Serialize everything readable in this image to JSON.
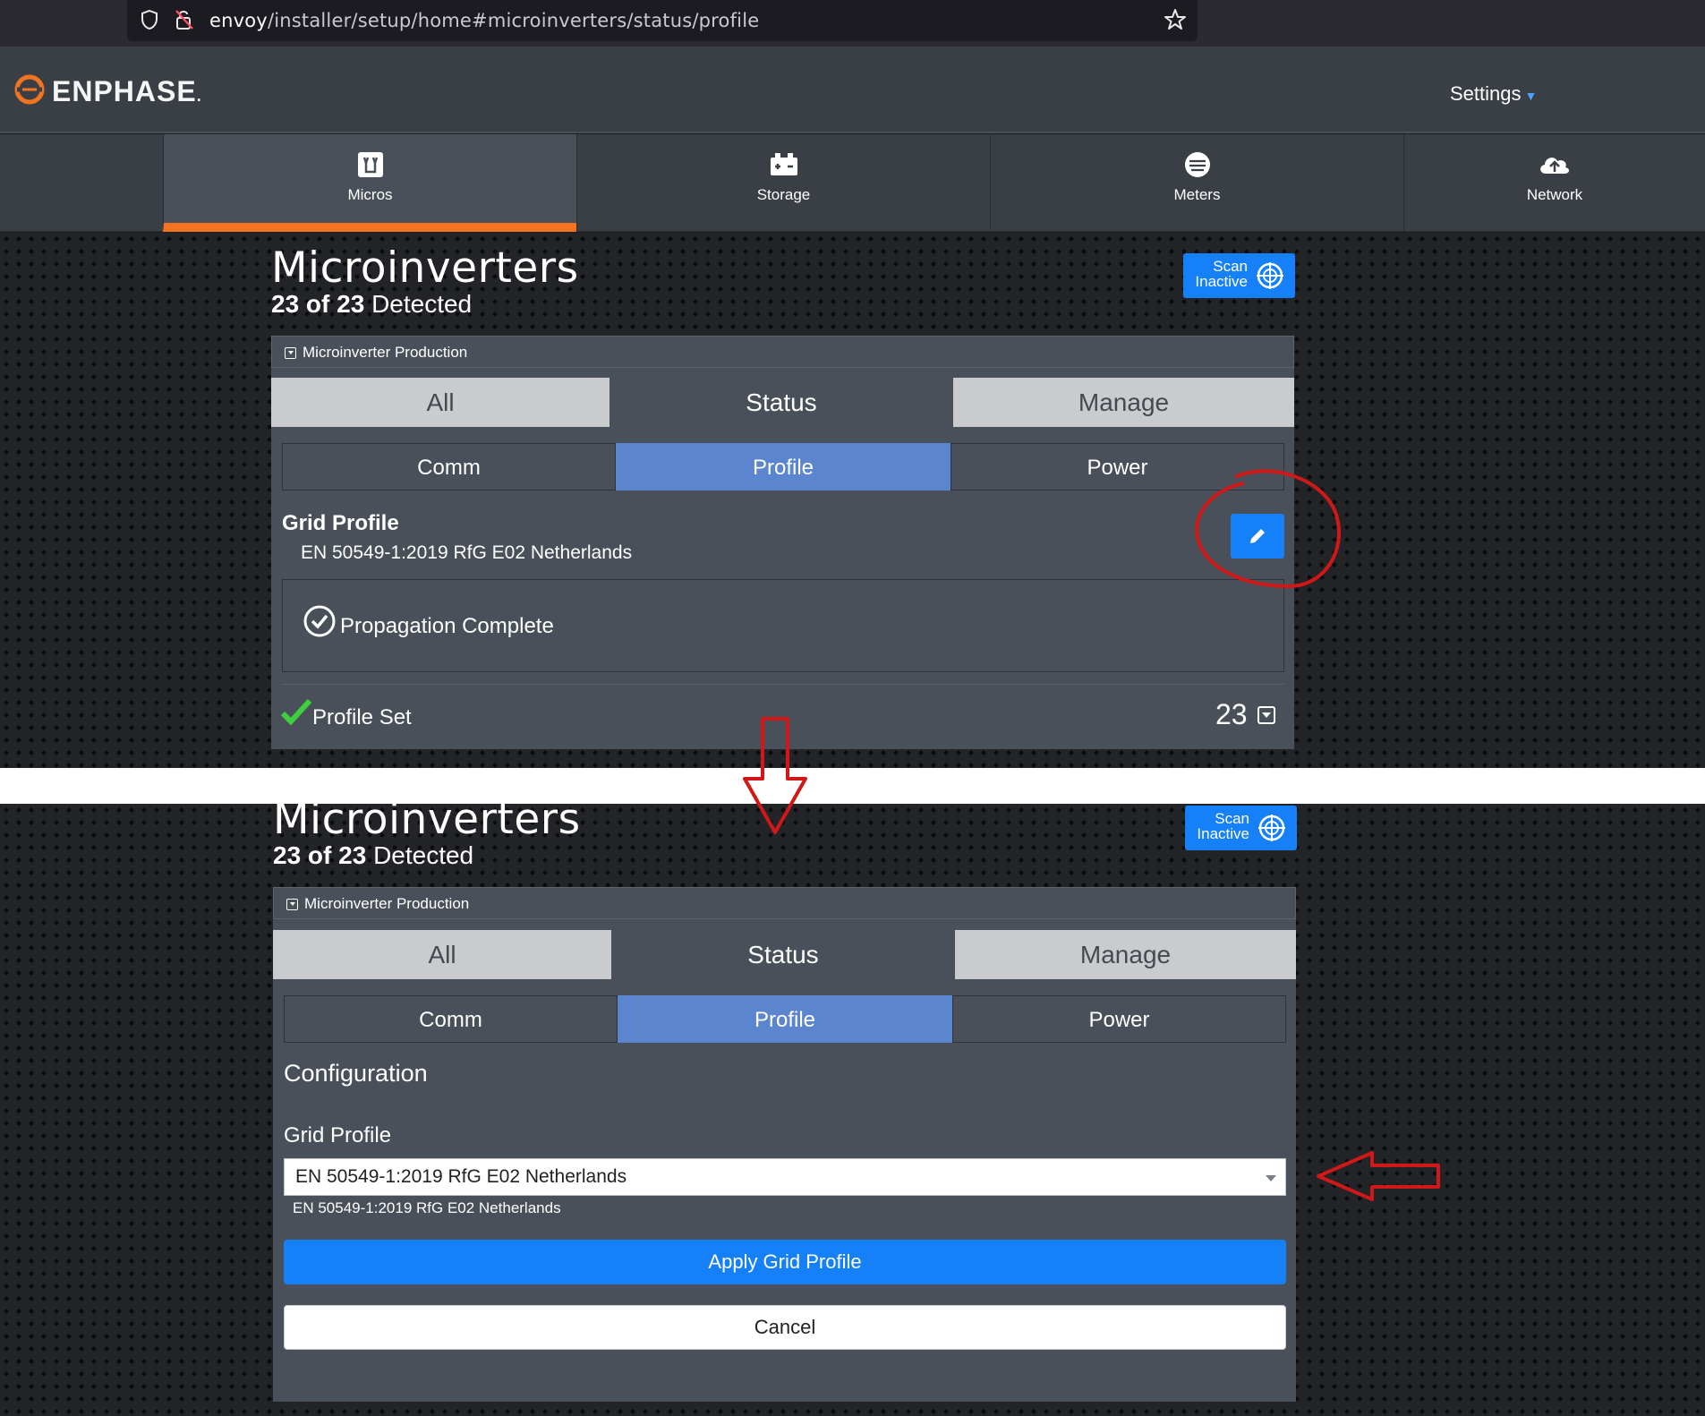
{
  "browser": {
    "url_host": "envoy",
    "url_path": "/installer/setup/home#microinverters/status/profile"
  },
  "header": {
    "logo_text": "ENPHASE",
    "logo_suffix": ".",
    "settings_label": "Settings"
  },
  "nav": {
    "tabs": [
      {
        "label": "Micros",
        "icon": "micro-icon"
      },
      {
        "label": "Storage",
        "icon": "battery-icon"
      },
      {
        "label": "Meters",
        "icon": "meter-icon"
      },
      {
        "label": "Network",
        "icon": "cloud-upload-icon"
      }
    ]
  },
  "top": {
    "title": "Microinverters",
    "detected_count": "23 of 23",
    "detected_label": "Detected",
    "scan_line1": "Scan",
    "scan_line2": "Inactive",
    "production_label": "Microinverter Production",
    "main_tabs": [
      "All",
      "Status",
      "Manage"
    ],
    "sub_tabs": [
      "Comm",
      "Profile",
      "Power"
    ],
    "grid_profile_heading": "Grid Profile",
    "grid_profile_value": "EN 50549-1:2019 RfG E02 Netherlands",
    "propagation_text": "Propagation Complete",
    "profile_set_label": "Profile Set",
    "profile_set_count": "23"
  },
  "bottom": {
    "title": "Microinverters",
    "detected_count": "23 of 23",
    "detected_label": "Detected",
    "scan_line1": "Scan",
    "scan_line2": "Inactive",
    "production_label": "Microinverter Production",
    "main_tabs": [
      "All",
      "Status",
      "Manage"
    ],
    "sub_tabs": [
      "Comm",
      "Profile",
      "Power"
    ],
    "configuration_heading": "Configuration",
    "grid_profile_label": "Grid Profile",
    "grid_profile_selected": "EN 50549-1:2019 RfG E02 Netherlands",
    "grid_profile_hint": "EN 50549-1:2019 RfG E02 Netherlands",
    "apply_label": "Apply Grid Profile",
    "cancel_label": "Cancel"
  },
  "colors": {
    "accent_orange": "#f37321",
    "primary_blue": "#1580f8",
    "active_subtab": "#5b85cf",
    "annotation_red": "#d01818",
    "check_green": "#3ecf3e"
  }
}
